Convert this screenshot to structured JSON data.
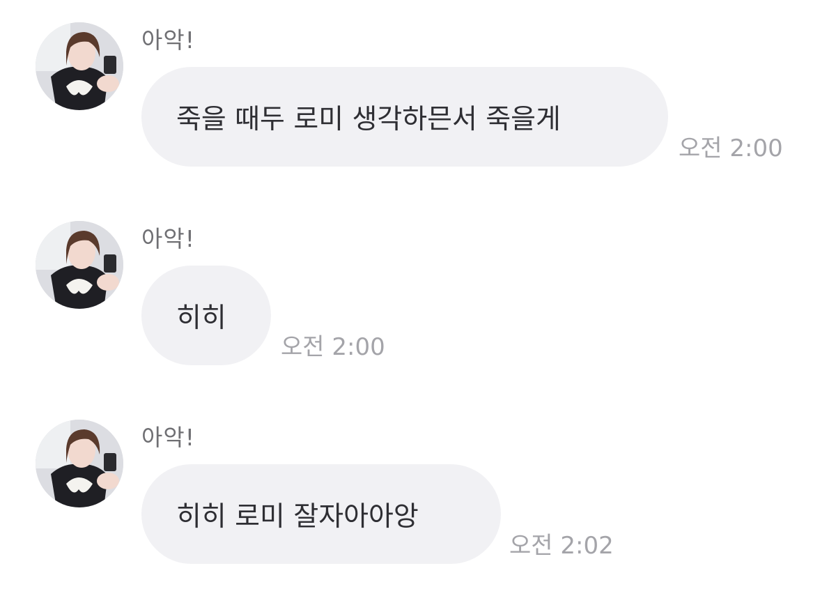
{
  "messages": [
    {
      "sender": "아악!",
      "text": "죽을 때두 로미 생각하믄서 죽을게",
      "time": "오전 2:00",
      "avatar": "profile-photo"
    },
    {
      "sender": "아악!",
      "text": "히히",
      "time": "오전 2:00",
      "avatar": "profile-photo"
    },
    {
      "sender": "아악!",
      "text": "히히 로미 잘자아아앙",
      "time": "오전 2:02",
      "avatar": "profile-photo"
    }
  ],
  "colors": {
    "background": "#ffffff",
    "bubble": "#f1f1f4",
    "message_text": "#2e2e33",
    "sender_text": "#6f6f73",
    "timestamp_text": "#a4a4a9"
  }
}
